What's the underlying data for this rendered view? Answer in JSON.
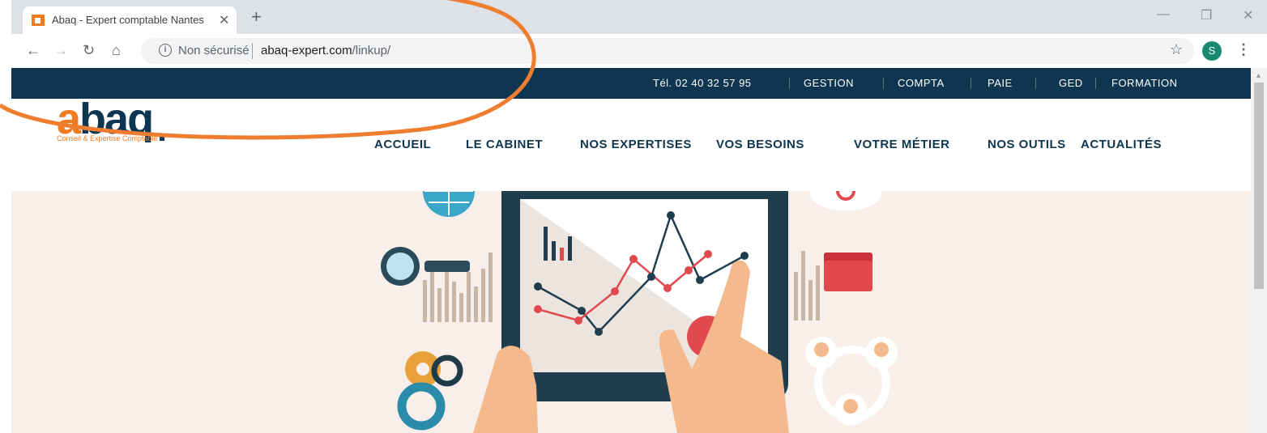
{
  "browser": {
    "tab_title": "Abaq - Expert comptable Nantes",
    "tab_close": "✕",
    "new_tab": "+",
    "not_secure": "Non sécurisé",
    "url_domain": "abaq-expert.com",
    "url_path": "/linkup/",
    "profile_initial": "S",
    "window_minimize": "—",
    "window_restore": "❐",
    "window_close": "✕"
  },
  "topbar": {
    "phone": "Tél. 02 40 32 57 95",
    "links": [
      "GESTION",
      "COMPTA",
      "PAIE",
      "GED",
      "FORMATION"
    ]
  },
  "logo": {
    "letter": "a",
    "rest": "baq",
    "tagline": "Conseil & Expertise Comptable"
  },
  "main_nav": [
    "ACCUEIL",
    "LE CABINET",
    "NOS EXPERTISES",
    "VOS BESOINS",
    "VOTRE MÉTIER",
    "NOS OUTILS",
    "ACTUALITÉS"
  ],
  "colors": {
    "brand_orange": "#f07c22",
    "brand_navy": "#0e3650",
    "hero_bg": "#f8eeea"
  }
}
